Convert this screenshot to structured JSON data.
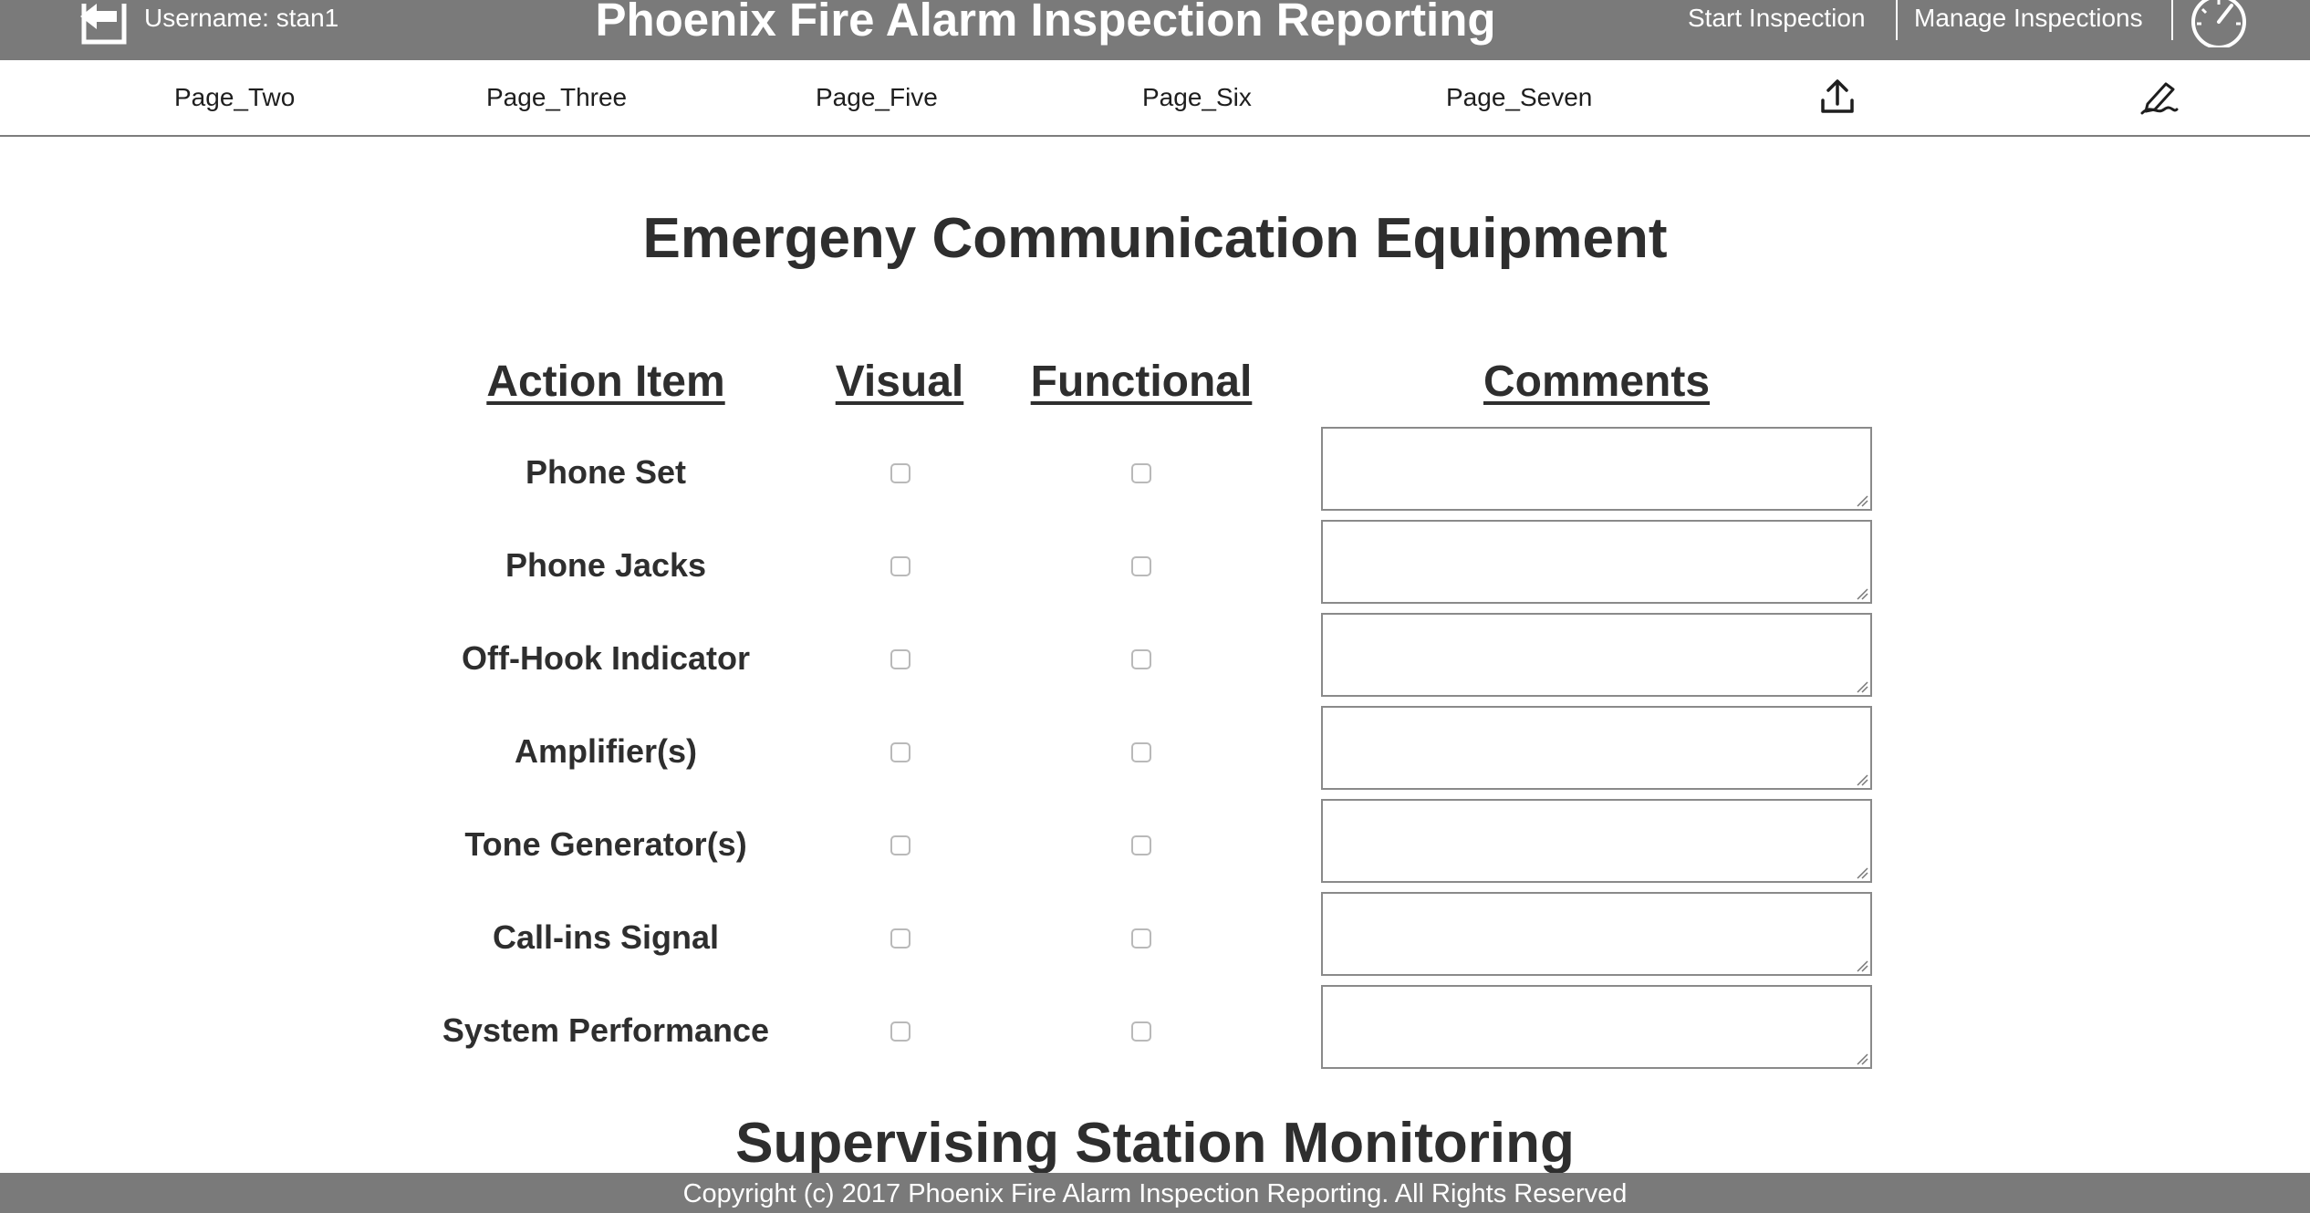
{
  "header": {
    "username_label": "Username: stan1",
    "app_title": "Phoenix Fire Alarm Inspection Reporting",
    "start_inspection": "Start Inspection",
    "manage_inspections": "Manage Inspections",
    "icons": {
      "back": "back-arrow-icon",
      "dashboard": "speedometer-icon"
    }
  },
  "subnav": {
    "items": [
      "Page_Two",
      "Page_Three",
      "Page_Five",
      "Page_Six",
      "Page_Seven"
    ],
    "icons": {
      "upload": "upload-icon",
      "sign": "signature-icon"
    }
  },
  "section": {
    "title": "Emergeny Communication Equipment",
    "columns": {
      "action_item": "Action Item",
      "visual": "Visual",
      "functional": "Functional",
      "comments": "Comments"
    },
    "rows": [
      {
        "label": "Phone Set",
        "visual": false,
        "functional": false,
        "comment": ""
      },
      {
        "label": "Phone Jacks",
        "visual": false,
        "functional": false,
        "comment": ""
      },
      {
        "label": "Off-Hook Indicator",
        "visual": false,
        "functional": false,
        "comment": ""
      },
      {
        "label": "Amplifier(s)",
        "visual": false,
        "functional": false,
        "comment": ""
      },
      {
        "label": "Tone Generator(s)",
        "visual": false,
        "functional": false,
        "comment": ""
      },
      {
        "label": "Call-ins Signal",
        "visual": false,
        "functional": false,
        "comment": ""
      },
      {
        "label": "System Performance",
        "visual": false,
        "functional": false,
        "comment": ""
      }
    ]
  },
  "next_section": {
    "title": "Supervising Station Monitoring"
  },
  "footer": {
    "copyright": "Copyright (c) 2017 Phoenix Fire Alarm Inspection Reporting. All Rights Reserved"
  },
  "colors": {
    "bar_gray": "#7a7a7a",
    "text_dark": "#2e2e2e",
    "white": "#ffffff"
  }
}
